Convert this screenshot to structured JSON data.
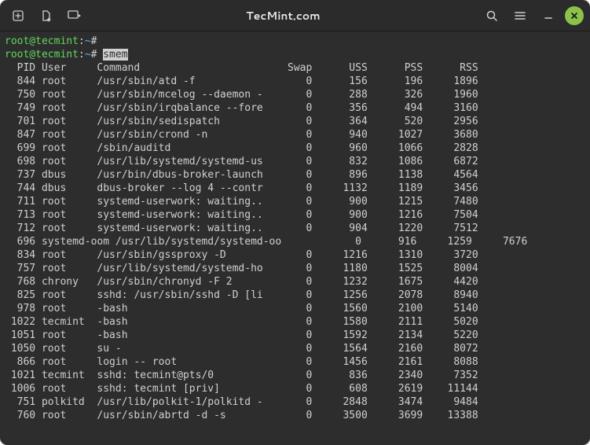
{
  "window": {
    "title": "TecMint.com"
  },
  "prompt": {
    "user": "root",
    "host": "tecmint",
    "path": "~",
    "symbol": "#",
    "command": "smem"
  },
  "table": {
    "headers": {
      "pid": "PID",
      "user": "User",
      "command": "Command",
      "swap": "Swap",
      "uss": "USS",
      "pss": "PSS",
      "rss": "RSS"
    },
    "rows": [
      {
        "pid": "844",
        "user": "root",
        "cmd": "/usr/sbin/atd -f",
        "swap": "0",
        "uss": "156",
        "pss": "196",
        "rss": "1896"
      },
      {
        "pid": "750",
        "user": "root",
        "cmd": "/usr/sbin/mcelog --daemon -",
        "swap": "0",
        "uss": "288",
        "pss": "326",
        "rss": "1960"
      },
      {
        "pid": "749",
        "user": "root",
        "cmd": "/usr/sbin/irqbalance --fore",
        "swap": "0",
        "uss": "356",
        "pss": "494",
        "rss": "3160"
      },
      {
        "pid": "701",
        "user": "root",
        "cmd": "/usr/sbin/sedispatch",
        "swap": "0",
        "uss": "364",
        "pss": "520",
        "rss": "2956"
      },
      {
        "pid": "847",
        "user": "root",
        "cmd": "/usr/sbin/crond -n",
        "swap": "0",
        "uss": "940",
        "pss": "1027",
        "rss": "3680"
      },
      {
        "pid": "699",
        "user": "root",
        "cmd": "/sbin/auditd",
        "swap": "0",
        "uss": "960",
        "pss": "1066",
        "rss": "2828"
      },
      {
        "pid": "698",
        "user": "root",
        "cmd": "/usr/lib/systemd/systemd-us",
        "swap": "0",
        "uss": "832",
        "pss": "1086",
        "rss": "6872"
      },
      {
        "pid": "737",
        "user": "dbus",
        "cmd": "/usr/bin/dbus-broker-launch",
        "swap": "0",
        "uss": "896",
        "pss": "1138",
        "rss": "4564"
      },
      {
        "pid": "744",
        "user": "dbus",
        "cmd": "dbus-broker --log 4 --contr",
        "swap": "0",
        "uss": "1132",
        "pss": "1189",
        "rss": "3456"
      },
      {
        "pid": "711",
        "user": "root",
        "cmd": "systemd-userwork: waiting..",
        "swap": "0",
        "uss": "900",
        "pss": "1215",
        "rss": "7480"
      },
      {
        "pid": "713",
        "user": "root",
        "cmd": "systemd-userwork: waiting..",
        "swap": "0",
        "uss": "900",
        "pss": "1216",
        "rss": "7504"
      },
      {
        "pid": "712",
        "user": "root",
        "cmd": "systemd-userwork: waiting..",
        "swap": "0",
        "uss": "904",
        "pss": "1220",
        "rss": "7512"
      },
      {
        "pid": "696",
        "user": "systemd-oom",
        "cmd": "/usr/lib/systemd/systemd-oo",
        "swap": "0",
        "uss": "916",
        "pss": "1259",
        "rss": "7676",
        "long": true
      },
      {
        "pid": "834",
        "user": "root",
        "cmd": "/usr/sbin/gssproxy -D",
        "swap": "0",
        "uss": "1216",
        "pss": "1310",
        "rss": "3720"
      },
      {
        "pid": "757",
        "user": "root",
        "cmd": "/usr/lib/systemd/systemd-ho",
        "swap": "0",
        "uss": "1180",
        "pss": "1525",
        "rss": "8004"
      },
      {
        "pid": "768",
        "user": "chrony",
        "cmd": "/usr/sbin/chronyd -F 2",
        "swap": "0",
        "uss": "1232",
        "pss": "1675",
        "rss": "4420"
      },
      {
        "pid": "825",
        "user": "root",
        "cmd": "sshd: /usr/sbin/sshd -D [li",
        "swap": "0",
        "uss": "1256",
        "pss": "2078",
        "rss": "8940"
      },
      {
        "pid": "978",
        "user": "root",
        "cmd": "-bash",
        "swap": "0",
        "uss": "1560",
        "pss": "2100",
        "rss": "5140"
      },
      {
        "pid": "1022",
        "user": "tecmint",
        "cmd": "-bash",
        "swap": "0",
        "uss": "1580",
        "pss": "2111",
        "rss": "5020"
      },
      {
        "pid": "1051",
        "user": "root",
        "cmd": "-bash",
        "swap": "0",
        "uss": "1592",
        "pss": "2134",
        "rss": "5220"
      },
      {
        "pid": "1050",
        "user": "root",
        "cmd": "su -",
        "swap": "0",
        "uss": "1564",
        "pss": "2160",
        "rss": "8072"
      },
      {
        "pid": "866",
        "user": "root",
        "cmd": "login -- root",
        "swap": "0",
        "uss": "1456",
        "pss": "2161",
        "rss": "8088"
      },
      {
        "pid": "1021",
        "user": "tecmint",
        "cmd": "sshd: tecmint@pts/0",
        "swap": "0",
        "uss": "836",
        "pss": "2340",
        "rss": "7352"
      },
      {
        "pid": "1006",
        "user": "root",
        "cmd": "sshd: tecmint [priv]",
        "swap": "0",
        "uss": "608",
        "pss": "2619",
        "rss": "11144"
      },
      {
        "pid": "751",
        "user": "polkitd",
        "cmd": "/usr/lib/polkit-1/polkitd -",
        "swap": "0",
        "uss": "2848",
        "pss": "3474",
        "rss": "9484"
      },
      {
        "pid": "760",
        "user": "root",
        "cmd": "/usr/sbin/abrtd -d -s",
        "swap": "0",
        "uss": "3500",
        "pss": "3699",
        "rss": "13388"
      }
    ]
  }
}
